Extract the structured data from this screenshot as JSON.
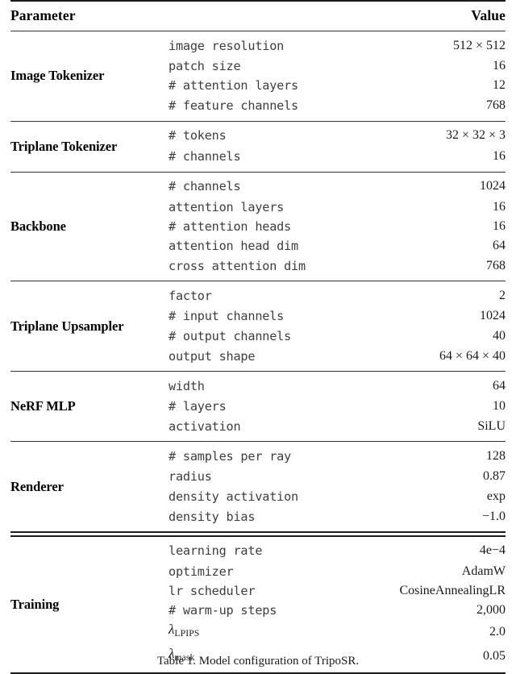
{
  "table": {
    "header": {
      "parameter": "Parameter",
      "value": "Value"
    },
    "sections": [
      {
        "label": "Image Tokenizer",
        "rows": [
          {
            "param": "image resolution",
            "value": "512 × 512"
          },
          {
            "param": "patch size",
            "value": "16"
          },
          {
            "param": "# attention layers",
            "value": "12"
          },
          {
            "param": "# feature channels",
            "value": "768"
          }
        ]
      },
      {
        "label": "Triplane Tokenizer",
        "rows": [
          {
            "param": "# tokens",
            "value": "32 × 32 × 3"
          },
          {
            "param": "# channels",
            "value": "16"
          }
        ]
      },
      {
        "label": "Backbone",
        "rows": [
          {
            "param": "# channels",
            "value": "1024"
          },
          {
            "param": "attention layers",
            "value": "16"
          },
          {
            "param": "# attention heads",
            "value": "16"
          },
          {
            "param": "attention head dim",
            "value": "64"
          },
          {
            "param": "cross attention dim",
            "value": "768"
          }
        ]
      },
      {
        "label": "Triplane Upsampler",
        "rows": [
          {
            "param": "factor",
            "value": "2"
          },
          {
            "param": "# input channels",
            "value": "1024"
          },
          {
            "param": "# output channels",
            "value": "40"
          },
          {
            "param": "output shape",
            "value": "64 × 64 × 40"
          }
        ]
      },
      {
        "label": "NeRF MLP",
        "rows": [
          {
            "param": "width",
            "value": "64"
          },
          {
            "param": "# layers",
            "value": "10"
          },
          {
            "param": "activation",
            "value": "SiLU"
          }
        ]
      },
      {
        "label": "Renderer",
        "rows": [
          {
            "param": "# samples per ray",
            "value": "128"
          },
          {
            "param": "radius",
            "value": "0.87"
          },
          {
            "param": "density activation",
            "value": "exp"
          },
          {
            "param": "density bias",
            "value": "−1.0"
          }
        ]
      },
      {
        "label": "Training",
        "rows": [
          {
            "param": "learning rate",
            "value": "4e−4"
          },
          {
            "param": "optimizer",
            "value": "AdamW"
          },
          {
            "param": "lr scheduler",
            "value": "CosineAnnealingLR"
          },
          {
            "param": "# warm-up steps",
            "value": "2,000"
          },
          {
            "param": "lambda_LPIPS",
            "symbol": "λ",
            "subscript": "LPIPS",
            "value": "2.0"
          },
          {
            "param": "lambda_mask",
            "symbol": "λ",
            "subscript": "mask",
            "value": "0.05"
          }
        ]
      }
    ]
  },
  "caption": {
    "text": "Table 1. Model configuration of TripoSR."
  }
}
